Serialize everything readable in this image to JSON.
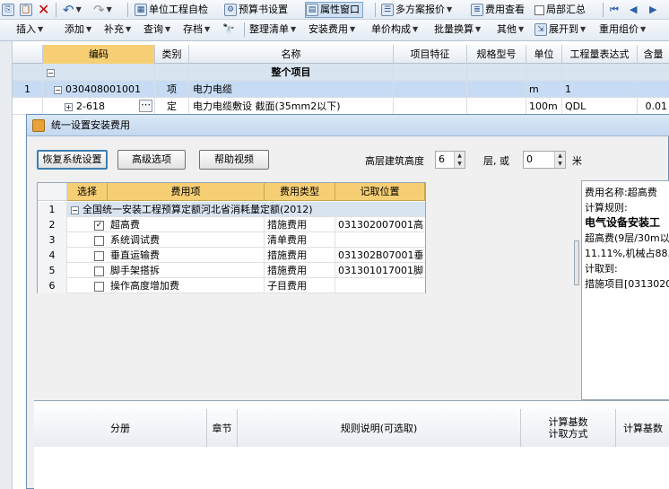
{
  "toolbar1": {
    "items": [
      {
        "label": "单位工程自检"
      },
      {
        "label": "预算书设置"
      },
      {
        "label": "属性窗口"
      },
      {
        "label": "多方案报价"
      },
      {
        "label": "费用查看"
      },
      {
        "label": "局部汇总"
      }
    ]
  },
  "toolbar2": {
    "items": [
      {
        "label": "插入"
      },
      {
        "label": "添加"
      },
      {
        "label": "补充"
      },
      {
        "label": "查询"
      },
      {
        "label": "存档"
      },
      {
        "label": "整理清单"
      },
      {
        "label": "安装费用"
      },
      {
        "label": "单价构成"
      },
      {
        "label": "批量换算"
      },
      {
        "label": "其他"
      },
      {
        "label": "展开到"
      },
      {
        "label": "重用组价"
      }
    ]
  },
  "grid": {
    "headers": [
      "编码",
      "类别",
      "名称",
      "项目特征",
      "规格型号",
      "单位",
      "工程量表达式",
      "含量"
    ],
    "rows": [
      {
        "num": "",
        "code": "",
        "type": "",
        "name": "整个项目",
        "unit": "",
        "expr": "",
        "content": ""
      },
      {
        "num": "1",
        "code": "030408001001",
        "type": "项",
        "name": "电力电缆",
        "unit": "m",
        "expr": "1",
        "content": ""
      },
      {
        "num": "",
        "code": "2-618",
        "type": "定",
        "name": "电力电缆敷设 截面(35mm2以下)",
        "unit": "100m",
        "expr": "QDL",
        "content": "0.01"
      }
    ]
  },
  "dialog": {
    "title": "统一设置安装费用",
    "buttons": {
      "restore": "恢复系统设置",
      "advanced": "高级选项",
      "help_video": "帮助视频"
    },
    "height_label": "高层建筑高度",
    "floors_value": "6",
    "floors_unit": "层, 或",
    "meters_value": "0",
    "meters_unit": "米",
    "fee_table": {
      "headers": [
        "选择",
        "费用项",
        "费用类型",
        "记取位置"
      ],
      "group_num": "1",
      "group_label": "全国统一安装工程预算定额河北省消耗量定额(2012)",
      "rows": [
        {
          "num": "2",
          "checked": true,
          "name": "超高费",
          "type": "措施费用",
          "pos": "031302007001高"
        },
        {
          "num": "3",
          "checked": false,
          "name": "系统调试费",
          "type": "清单费用",
          "pos": ""
        },
        {
          "num": "4",
          "checked": false,
          "name": "垂直运输费",
          "type": "措施费用",
          "pos": "031302B07001垂"
        },
        {
          "num": "5",
          "checked": false,
          "name": "脚手架搭拆",
          "type": "措施费用",
          "pos": "031301017001脚"
        },
        {
          "num": "6",
          "checked": false,
          "name": "操作高度增加费",
          "type": "子目费用",
          "pos": ""
        }
      ]
    },
    "info_lines": [
      "费用名称:超高费",
      "计算规则:",
      "电气设备安装工",
      "超高费(9层/30m以",
      "11.11%,机械占88.",
      "计取到:",
      "措施项目[0313020"
    ],
    "bottom_headers": [
      "分册",
      "章节",
      "规则说明(可选取)",
      "计算基数\n计取方式",
      "计算基数"
    ]
  }
}
